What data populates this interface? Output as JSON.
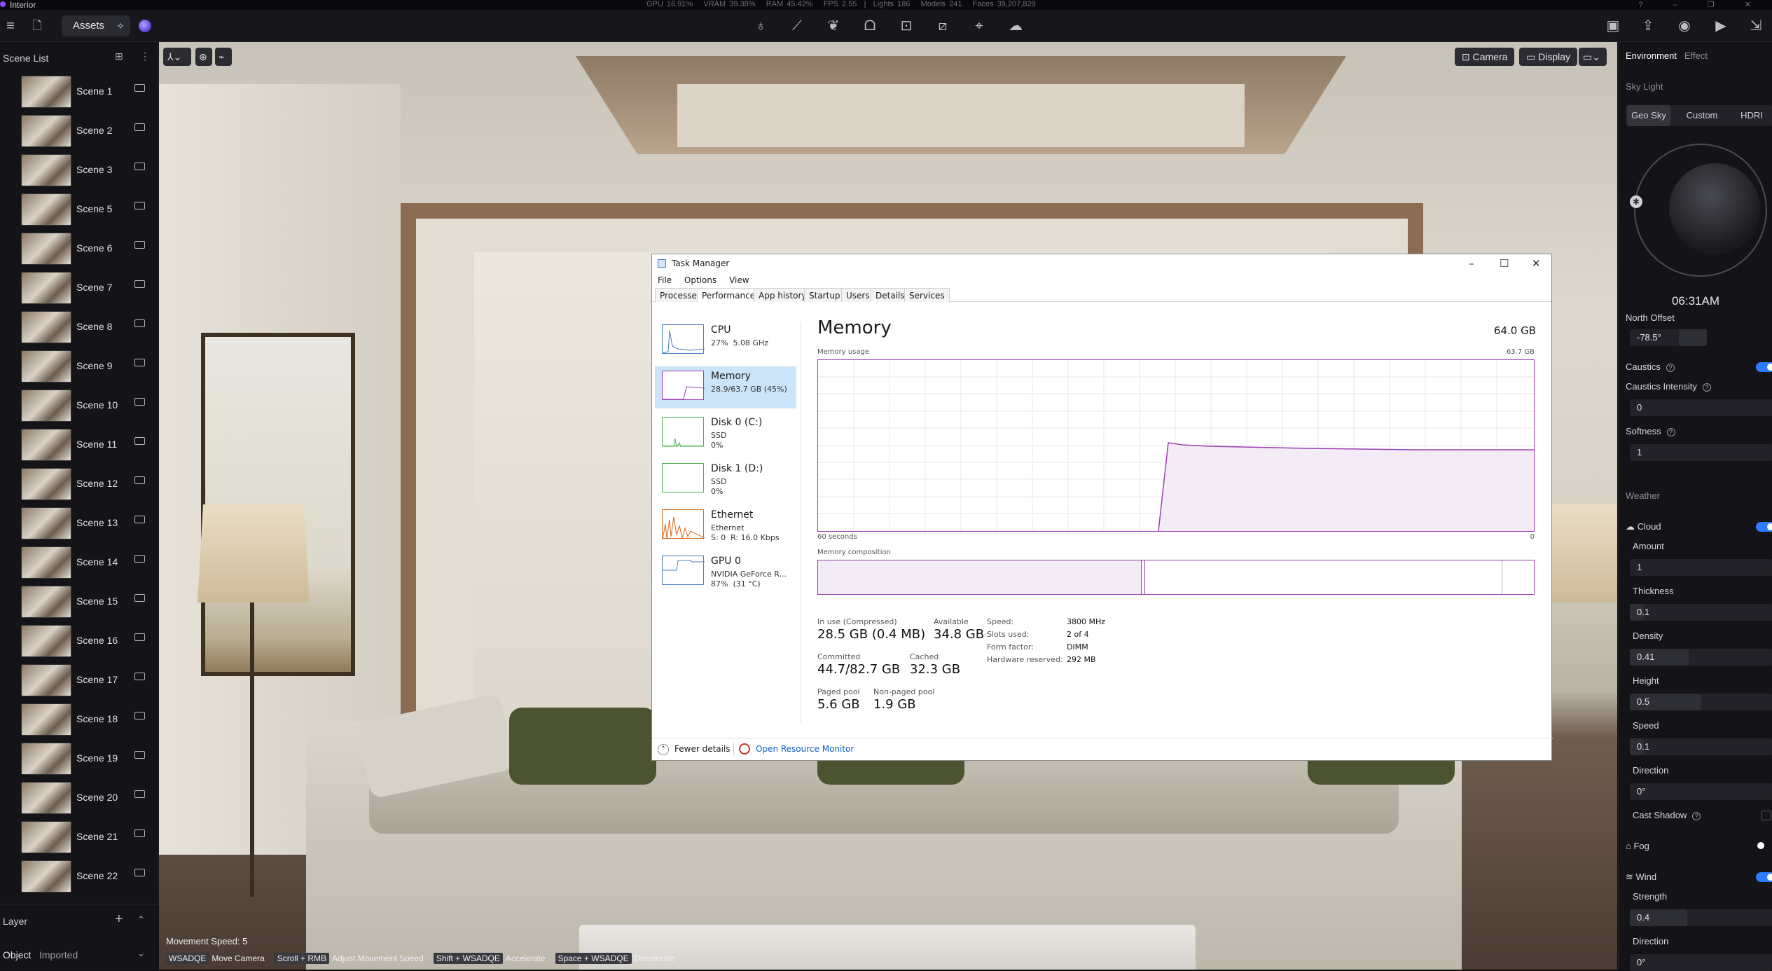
{
  "app": {
    "title": "Interior"
  },
  "status": {
    "gpu": "GPU 16.91%",
    "vram": "VRAM 39.38%",
    "ram": "RAM 45.42%",
    "fps": "FPS 2.55",
    "lights": "Lights 186",
    "models": "Models 241",
    "faces": "Faces 39,207,829"
  },
  "toolbar": {
    "assets_label": "Assets"
  },
  "sidebar": {
    "title": "Scene List",
    "scenes": [
      "Scene 1",
      "Scene 2",
      "Scene 3",
      "Scene 5",
      "Scene 6",
      "Scene 7",
      "Scene 8",
      "Scene 9",
      "Scene 10",
      "Scene 11",
      "Scene 12",
      "Scene 13",
      "Scene 14",
      "Scene 15",
      "Scene 16",
      "Scene 17",
      "Scene 18",
      "Scene 19",
      "Scene 20",
      "Scene 21",
      "Scene 22"
    ]
  },
  "layer": {
    "title": "Layer",
    "object_label": "Object",
    "filter": "Imported"
  },
  "viewport": {
    "camera_btn": "Camera",
    "display_btn": "Display",
    "movement_speed": "Movement Speed: 5",
    "hints": [
      {
        "key": "WSADQE",
        "desc": "Move Camera"
      },
      {
        "key": "Scroll + RMB",
        "desc": "Adjust Movement Speed"
      },
      {
        "key": "Shift + WSADQE",
        "desc": "Accelerate"
      },
      {
        "key": "Space + WSADQE",
        "desc": "Decelerate"
      }
    ]
  },
  "right_panel": {
    "tabs": [
      "Environment",
      "Effect"
    ],
    "sky_light": "Sky Light",
    "sky_modes": [
      "Geo Sky",
      "Custom",
      "HDRI"
    ],
    "time": "06:31AM",
    "north_offset": {
      "label": "North Offset",
      "value": "-78.5°"
    },
    "caustics": "Caustics",
    "caustics_intensity": {
      "label": "Caustics Intensity",
      "value": "0"
    },
    "softness": {
      "label": "Softness",
      "value": "1"
    },
    "weather": "Weather",
    "cloud": "Cloud",
    "amount": {
      "label": "Amount",
      "value": "1"
    },
    "thickness": {
      "label": "Thickness",
      "value": "0.1"
    },
    "density": {
      "label": "Density",
      "value": "0.41"
    },
    "height": {
      "label": "Height",
      "value": "0.5"
    },
    "speed": {
      "label": "Speed",
      "value": "0.1"
    },
    "direction": {
      "label": "Direction",
      "value": "0°"
    },
    "cast_shadow": "Cast Shadow",
    "fog": "Fog",
    "wind": "Wind",
    "strength": {
      "label": "Strength",
      "value": "0.4"
    },
    "wind_direction": {
      "label": "Direction",
      "value": "0°"
    }
  },
  "task_manager": {
    "title": "Task Manager",
    "menu": [
      "File",
      "Options",
      "View"
    ],
    "tabs": [
      "Processes",
      "Performance",
      "App history",
      "Startup",
      "Users",
      "Details",
      "Services"
    ],
    "resources": [
      {
        "name": "CPU",
        "sub": "27%  5.08 GHz"
      },
      {
        "name": "Memory",
        "sub": "28.9/63.7 GB (45%)"
      },
      {
        "name": "Disk 0 (C:)",
        "sub": "SSD\n0%"
      },
      {
        "name": "Disk 1 (D:)",
        "sub": "SSD\n0%"
      },
      {
        "name": "Ethernet",
        "sub": "Ethernet\nS: 0  R: 16.0 Kbps"
      },
      {
        "name": "GPU 0",
        "sub": "NVIDIA GeForce R...\n87%  (31 °C)"
      }
    ],
    "heading": "Memory",
    "capacity": "64.0 GB",
    "usage_label": "Memory usage",
    "usage_max": "63.7 GB",
    "time_label": "60 seconds",
    "zero_label": "0",
    "composition_label": "Memory composition",
    "in_use": {
      "label": "In use (Compressed)",
      "value": "28.5 GB (0.4 MB)"
    },
    "available": {
      "label": "Available",
      "value": "34.8 GB"
    },
    "committed": {
      "label": "Committed",
      "value": "44.7/82.7 GB"
    },
    "cached": {
      "label": "Cached",
      "value": "32.3 GB"
    },
    "paged": {
      "label": "Paged pool",
      "value": "5.6 GB"
    },
    "nonpaged": {
      "label": "Non-paged pool",
      "value": "1.9 GB"
    },
    "speed": {
      "label": "Speed:",
      "value": "3800 MHz"
    },
    "slots": {
      "label": "Slots used:",
      "value": "2 of 4"
    },
    "form": {
      "label": "Form factor:",
      "value": "DIMM"
    },
    "reserved": {
      "label": "Hardware reserved:",
      "value": "292 MB"
    },
    "fewer_details": "Fewer details",
    "resource_monitor": "Open Resource Monitor"
  }
}
